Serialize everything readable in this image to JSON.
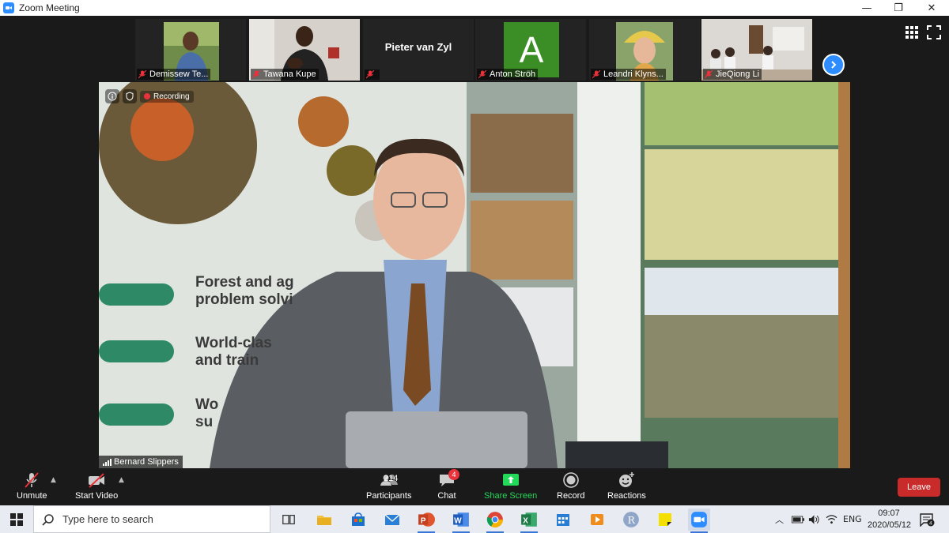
{
  "window": {
    "title": "Zoom Meeting"
  },
  "participants_strip": [
    {
      "name": "Demissew Te...",
      "muted": true
    },
    {
      "name": "Tawana Kupe",
      "muted": true
    },
    {
      "name": "Pieter van Zyl",
      "muted": true,
      "video": false
    },
    {
      "name": "Anton Ströh",
      "muted": true,
      "avatar_letter": "A",
      "avatar_color": "#3b8e25"
    },
    {
      "name": "Leandri Klyns...",
      "muted": true
    },
    {
      "name": "JieQiong Li",
      "muted": true
    }
  ],
  "main_video": {
    "recording_label": "Recording",
    "speaker_name": "Bernard Slippers",
    "poster_lines": [
      "Forest and ag",
      "problem solvi",
      "World-clas",
      "and train",
      "Wo",
      "su"
    ]
  },
  "toolbar": {
    "unmute": "Unmute",
    "start_video": "Start Video",
    "participants": "Participants",
    "participants_count": "214",
    "chat": "Chat",
    "chat_badge": "4",
    "share_screen": "Share Screen",
    "record": "Record",
    "reactions": "Reactions",
    "leave": "Leave"
  },
  "taskbar": {
    "search_placeholder": "Type here to search",
    "language": "ENG",
    "time": "09:07",
    "date": "2020/05/12",
    "notification_count": "4"
  },
  "colors": {
    "zoom_blue": "#2d8cff",
    "leave_red": "#c92a2a",
    "share_green": "#23d959",
    "mute_red": "#e8323c"
  }
}
